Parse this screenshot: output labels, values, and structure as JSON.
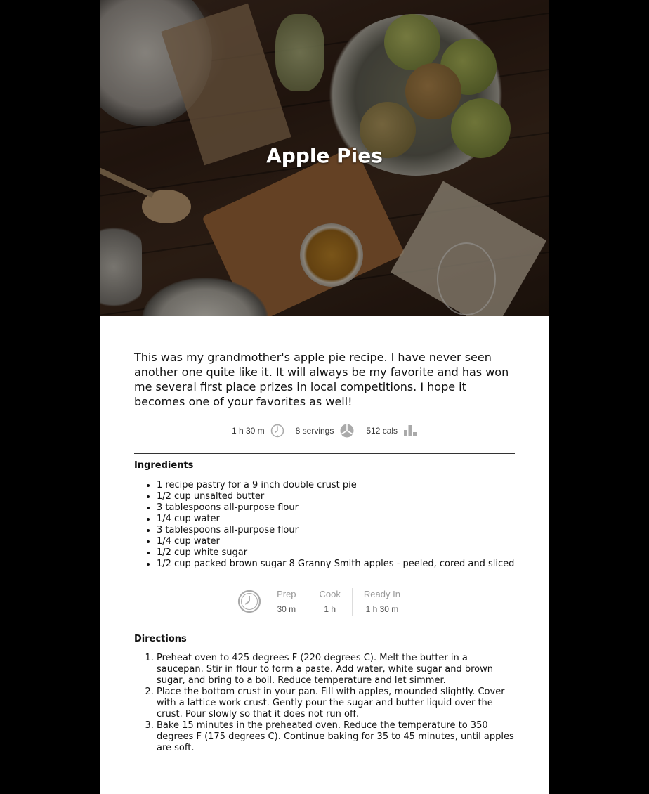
{
  "hero": {
    "title": "Apple Pies"
  },
  "intro": "This was my grandmother's apple pie recipe. I have never seen another one quite like it. It will always be my favorite and has won me several first place prizes in local competitions. I hope it becomes one of your favorites as well!",
  "stats": [
    {
      "label": "1 h 30 m",
      "icon": "clock-icon"
    },
    {
      "label": "8 servings",
      "icon": "servings-icon"
    },
    {
      "label": "512 cals",
      "icon": "calories-icon"
    }
  ],
  "ingredients": {
    "title": "Ingredients",
    "items": [
      "1 recipe pastry for a 9 inch double crust pie",
      "1/2 cup unsalted butter",
      "3 tablespoons all-purpose flour",
      "1/4 cup water",
      "3 tablespoons all-purpose flour",
      "1/4 cup water",
      "1/2 cup white sugar",
      "1/2 cup packed brown sugar 8 Granny Smith apples - peeled, cored and sliced"
    ]
  },
  "times": {
    "icon": "clock-icon",
    "prep": {
      "label": "Prep",
      "value": "30 m"
    },
    "cook": {
      "label": "Cook",
      "value": "1 h"
    },
    "ready": {
      "label": "Ready In",
      "value": "1 h 30 m"
    }
  },
  "directions": {
    "title": "Directions",
    "steps": [
      "Preheat oven to 425 degrees F (220 degrees C). Melt the butter in a saucepan. Stir in flour to form a paste. Add water, white sugar and brown sugar, and bring to a boil. Reduce temperature and let simmer.",
      "Place the bottom crust in your pan. Fill with apples, mounded slightly. Cover with a lattice work crust. Gently pour the sugar and butter liquid over the crust. Pour slowly so that it does not run off.",
      "Bake 15 minutes in the preheated oven. Reduce the temperature to 350 degrees F (175 degrees C). Continue baking for 35 to 45 minutes, until apples are soft."
    ]
  },
  "colors": {
    "background": "#000000",
    "page": "#ffffff",
    "text": "#111111",
    "icon": "#aaaaaa"
  }
}
